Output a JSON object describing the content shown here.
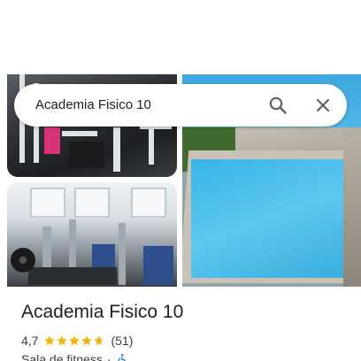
{
  "search": {
    "query": "Academia Fisico 10"
  },
  "place": {
    "name": "Academia Fisico 10",
    "rating": "4,7",
    "stars": 4.7,
    "review_count": "(51)",
    "category": "Sala de fitness",
    "separator": "·"
  },
  "icons": {
    "search": "search-icon",
    "close": "close-icon",
    "star": "star-icon",
    "accessibility": "wheelchair-icon"
  },
  "colors": {
    "star": "#f4b400",
    "accessibility": "#1a73e8",
    "icon_gray": "#5f6368"
  }
}
